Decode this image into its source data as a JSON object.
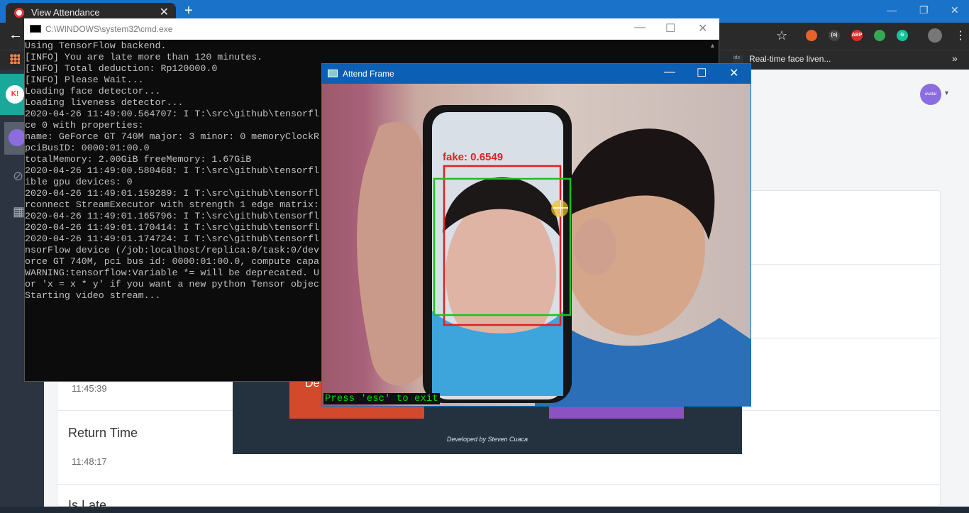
{
  "browser": {
    "tab_title": "View Attendance",
    "close_tab": "✕",
    "new_tab": "+",
    "window_controls": [
      "—",
      "❐",
      "✕"
    ],
    "back": "←",
    "star": "☆",
    "extensions": [
      {
        "name": "extension-1-icon",
        "label": "",
        "color": "#e8622c"
      },
      {
        "name": "extension-2-icon",
        "label": "(o)",
        "color": "#444444"
      },
      {
        "name": "adblock-icon",
        "label": "ABP",
        "color": "#d93025"
      },
      {
        "name": "extension-4-icon",
        "label": "",
        "color": "#34a853"
      },
      {
        "name": "grammarly-icon",
        "label": "G",
        "color": "#15c39a"
      },
      {
        "name": "extension-6-icon",
        "label": "",
        "color": "#777777"
      }
    ],
    "menu": "⋮",
    "bookmark": "Real-time face liven...",
    "bookmark_icon": "ids",
    "bookmarks_more": "»"
  },
  "cmd": {
    "title": "C:\\WINDOWS\\system32\\cmd.exe",
    "controls": [
      "—",
      "☐",
      "✕"
    ],
    "lines": [
      "Using TensorFlow backend.",
      "[INFO] You are late more than 120 minutes.",
      "[INFO] Total deduction: Rp120000.0",
      "[INFO] Please Wait...",
      "Loading face detector...",
      "Loading liveness detector...",
      "2020-04-26 11:49:00.564707: I T:\\src\\github\\tensorfl",
      "ce 0 with properties:",
      "name: GeForce GT 740M major: 3 minor: 0 memoryClockR",
      "pciBusID: 0000:01:00.0",
      "totalMemory: 2.00GiB freeMemory: 1.67GiB",
      "2020-04-26 11:49:00.580468: I T:\\src\\github\\tensorfl",
      "ible gpu devices: 0",
      "2020-04-26 11:49:01.159289: I T:\\src\\github\\tensorfl",
      "rconnect StreamExecutor with strength 1 edge matrix:",
      "2020-04-26 11:49:01.165796: I T:\\src\\github\\tensorfl",
      "2020-04-26 11:49:01.170414: I T:\\src\\github\\tensorfl",
      "2020-04-26 11:49:01.174724: I T:\\src\\github\\tensorfl",
      "nsorFlow device (/job:localhost/replica:0/task:0/dev",
      "orce GT 740M, pci bus id: 0000:01:00.0, compute capa",
      "WARNING:tensorflow:Variable *= will be deprecated. U",
      "or 'x = x * y' if you want a new python Tensor objec",
      "Starting video stream..."
    ]
  },
  "attend_frame": {
    "title": "Attend Frame",
    "controls": [
      "—",
      "☐",
      "✕"
    ],
    "prediction": "fake: 0.6549",
    "exit_hint": "Press 'esc' to exit",
    "colors": {
      "fake_box": "#e02020",
      "face_box": "#20c020"
    }
  },
  "page": {
    "left_time_value": "11:45:39",
    "return_time_label": "Return Time",
    "return_time_value": "11:48:17",
    "is_late_label": "Is Late",
    "dialog_button": "De",
    "footer": "Developed by Steven Cuaca",
    "logo": "K!",
    "profile_avatar": "avatar",
    "profile_caret": "▾",
    "rail_icons": [
      "⊘",
      "▦"
    ]
  }
}
